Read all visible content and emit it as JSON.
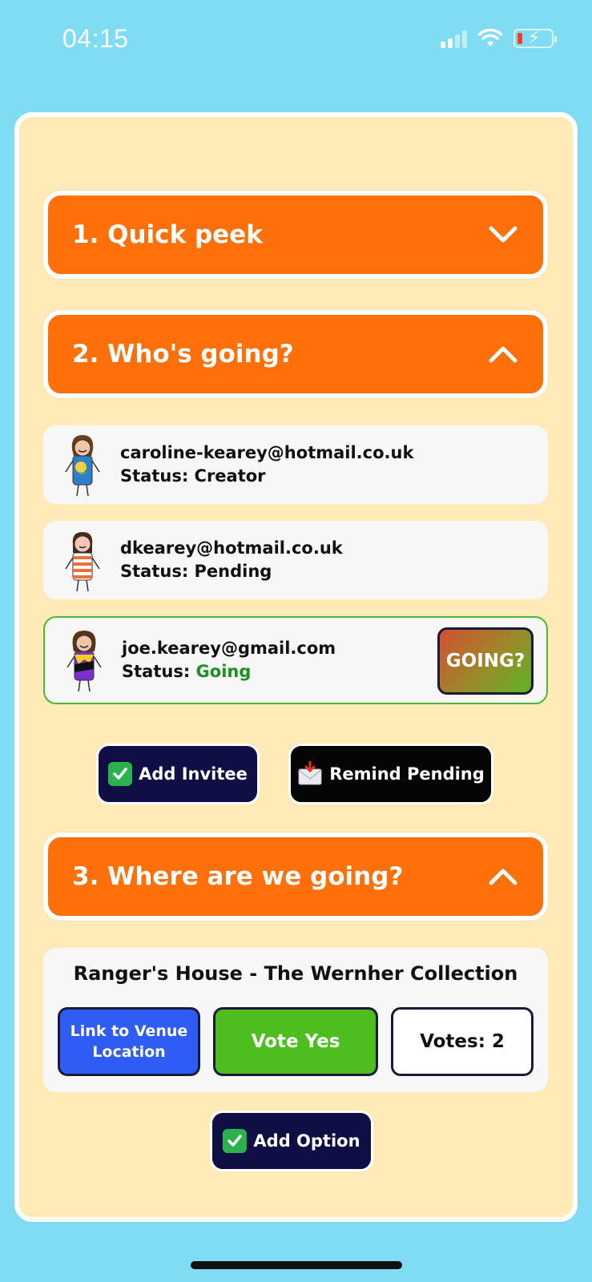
{
  "status_bar": {
    "time": "04:15"
  },
  "sections": [
    {
      "label": "1. Quick peek",
      "expanded": false
    },
    {
      "label": "2. Who's going?",
      "expanded": true
    },
    {
      "label": "3. Where are we going?",
      "expanded": true
    }
  ],
  "invitees": [
    {
      "email": "caroline-kearey@hotmail.co.uk",
      "status_prefix": "Status: ",
      "status": "Creator"
    },
    {
      "email": "dkearey@hotmail.co.uk",
      "status_prefix": "Status: ",
      "status": "Pending"
    },
    {
      "email": "joe.kearey@gmail.com",
      "status_prefix": "Status: ",
      "status": "Going",
      "action_label": "GOING?"
    }
  ],
  "invitee_actions": {
    "add_invitee": "Add Invitee",
    "remind_pending": "Remind Pending"
  },
  "venue": {
    "name": "Ranger's House - The Wernher Collection",
    "link_label": "Link to Venue Location",
    "vote_label": "Vote Yes",
    "votes_label": "Votes: 2"
  },
  "add_option_label": "Add Option",
  "colors": {
    "background": "#7fdcf2",
    "card": "#ffeab8",
    "section_header": "#ff6f0a",
    "going_green": "#1f8f1f",
    "link_blue": "#2f5cf5",
    "vote_green": "#4dbd1f",
    "dark_navy": "#0f0f45"
  },
  "icons": [
    "signal-icon",
    "wifi-icon",
    "battery-charging-icon",
    "chevron-down-icon",
    "chevron-up-icon",
    "check-mark-emoji-icon",
    "envelope-emoji-icon"
  ]
}
